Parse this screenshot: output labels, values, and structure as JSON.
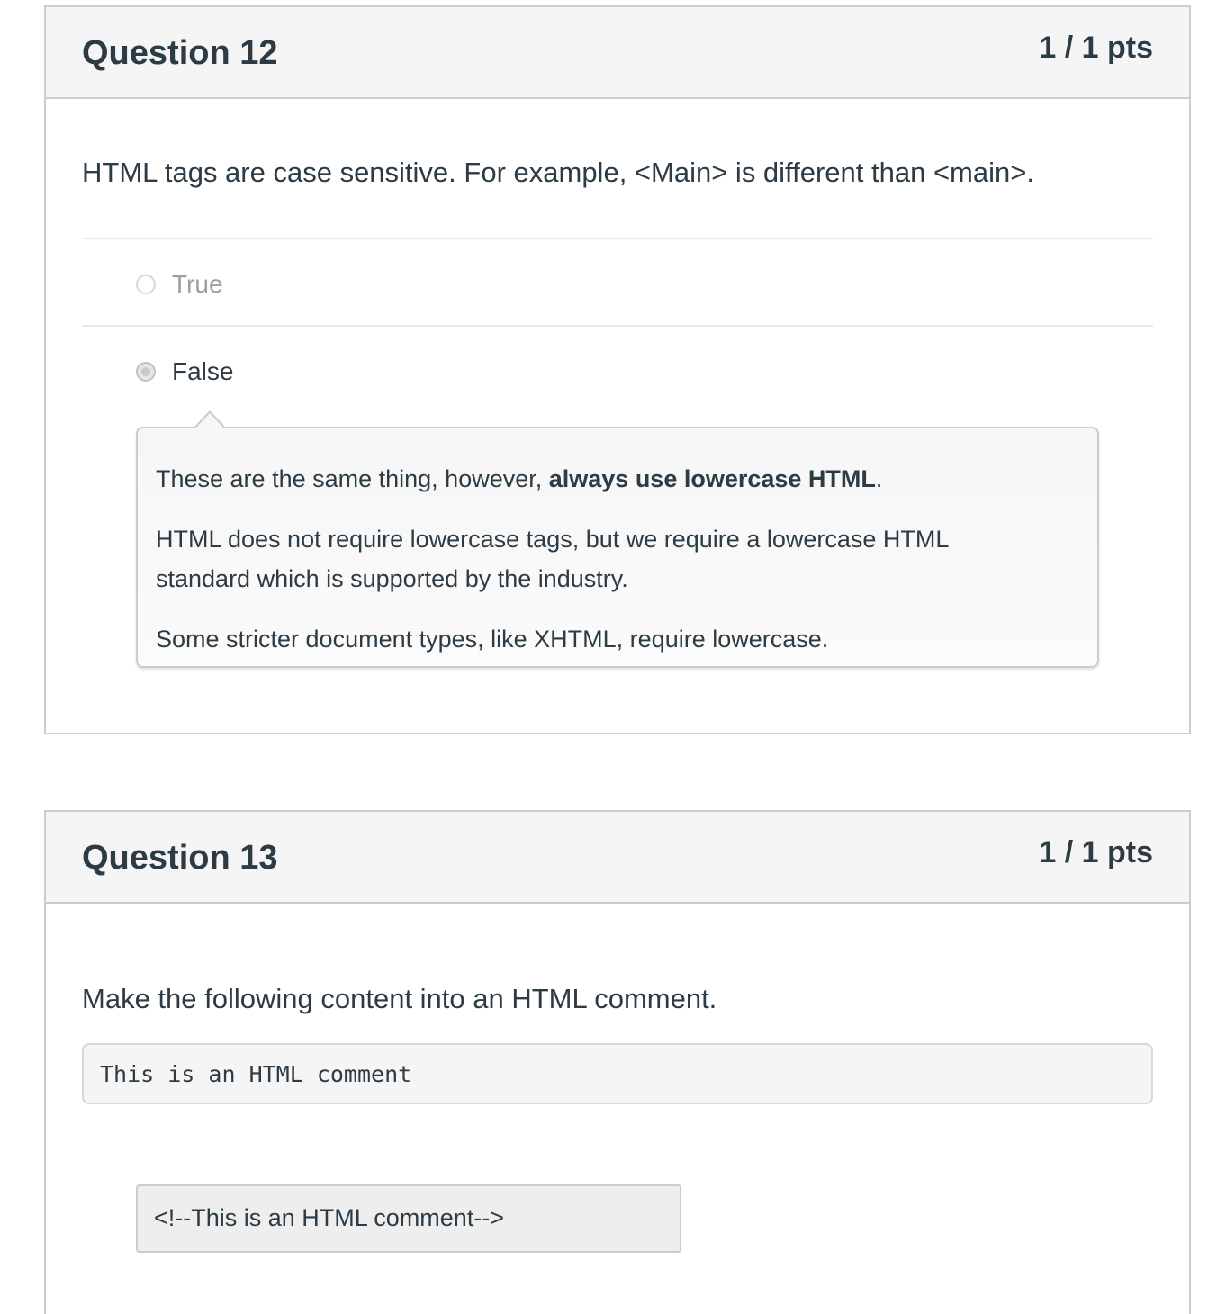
{
  "questions": [
    {
      "title": "Question 12",
      "points": "1 / 1 pts",
      "text": "HTML tags are case sensitive. For example, <Main> is different than <main>.",
      "answers": [
        {
          "label": "True",
          "selected": false
        },
        {
          "label": "False",
          "selected": true
        }
      ],
      "comment": {
        "p1_before": "These are the same thing, however, ",
        "p1_bold": "always use lowercase HTML",
        "p1_after": ".",
        "p2_line1": "HTML does not require lowercase tags, but we require a lowercase HTML",
        "p2_line2": "standard which is supported by the industry.",
        "p3": "Some stricter document types, like XHTML, require lowercase."
      }
    },
    {
      "title": "Question 13",
      "points": "1 / 1 pts",
      "text": "Make the following content into an HTML comment.",
      "code": "This is an HTML comment",
      "answer_value": "<!--This is an HTML comment-->"
    }
  ]
}
